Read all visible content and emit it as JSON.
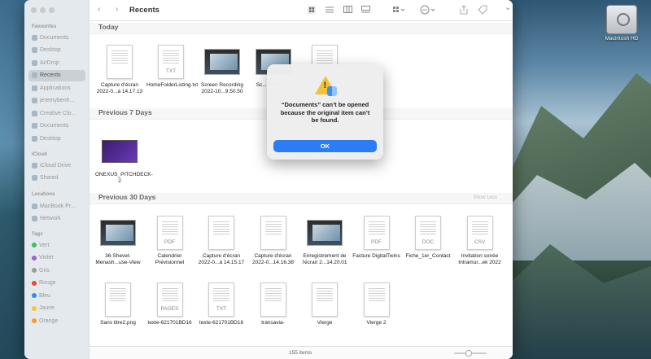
{
  "desktop": {
    "disk_label": "Macintosh HD"
  },
  "sidebar": {
    "favourites_label": "Favourites",
    "favourites": [
      "Documents",
      "Desktop",
      "AirDrop",
      "Recents",
      "Applications",
      "jeremybenh...",
      "Creative Clo...",
      "Documents",
      "Desktop"
    ],
    "active_index": 3,
    "icloud_label": "iCloud",
    "icloud": [
      "iCloud Drive",
      "Shared"
    ],
    "locations_label": "Locations",
    "locations": [
      "MacBook Pr...",
      "Network"
    ],
    "tags_label": "Tags",
    "tags": [
      {
        "label": "Vert",
        "color": "#3fbf5f"
      },
      {
        "label": "Violet",
        "color": "#a45cd6"
      },
      {
        "label": "Gris",
        "color": "#9a9a9a"
      },
      {
        "label": "Rouge",
        "color": "#f0453a"
      },
      {
        "label": "Bleu",
        "color": "#2f8cf0"
      },
      {
        "label": "Jaune",
        "color": "#f5c82e"
      },
      {
        "label": "Orange",
        "color": "#f59a2e"
      }
    ]
  },
  "toolbar": {
    "title": "Recents",
    "back": "‹",
    "forward": "›",
    "search": "⌕",
    "more": "⌄"
  },
  "sections": {
    "today": {
      "title": "Today",
      "items": [
        {
          "label": "Capture d'écran 2022-0...à 14.17.13",
          "kind": "doc",
          "ext": ""
        },
        {
          "label": "HomeFolderListing.txt",
          "kind": "doc",
          "ext": "TXT"
        },
        {
          "label": "Screen Recording 2022-10...9.50.50",
          "kind": "shot",
          "ext": ""
        },
        {
          "label": "Sc... Recordi...",
          "kind": "shot",
          "ext": ""
        },
        {
          "label": "",
          "kind": "doc",
          "ext": ""
        }
      ]
    },
    "prev7": {
      "title": "Previous 7 Days",
      "items": [
        {
          "label": "ONEXUS_PITCHDECK-2",
          "kind": "pitch",
          "ext": ""
        }
      ]
    },
    "prev30": {
      "title": "Previous 30 Days",
      "show_less": "Show Less",
      "items": [
        {
          "label": "36-Shevet-Menash...use-View",
          "kind": "shot",
          "ext": ""
        },
        {
          "label": "Calendrier Prévisionnel",
          "kind": "doc",
          "ext": "PDF"
        },
        {
          "label": "Capture d'écran 2022-0...à 14.15.17",
          "kind": "doc",
          "ext": ""
        },
        {
          "label": "Capture d'écran 2022-0...14.16.38",
          "kind": "doc",
          "ext": ""
        },
        {
          "label": "Enregistrement de l'écran 2...14.20.01",
          "kind": "shot",
          "ext": ""
        },
        {
          "label": "Facture DigitalTwins",
          "kind": "doc",
          "ext": "PDF"
        },
        {
          "label": "Fiche_1er_Contact",
          "kind": "doc",
          "ext": "DOC"
        },
        {
          "label": "Invitation soirée Intramur...ek 2022",
          "kind": "doc",
          "ext": "CSV"
        },
        {
          "label": "Sans titre2.png",
          "kind": "doc",
          "ext": ""
        },
        {
          "label": "texte-621701BD16",
          "kind": "doc",
          "ext": "PAGES"
        },
        {
          "label": "texte-621701BD16",
          "kind": "doc",
          "ext": "TXT"
        },
        {
          "label": "transavia-",
          "kind": "doc",
          "ext": ""
        },
        {
          "label": "Vierge",
          "kind": "doc",
          "ext": ""
        },
        {
          "label": "Vierge 2",
          "kind": "doc",
          "ext": ""
        }
      ]
    }
  },
  "status": {
    "text": "155 items"
  },
  "alert": {
    "message": "“Documents” can’t be opened because the original item can’t be found.",
    "ok_label": "OK"
  }
}
